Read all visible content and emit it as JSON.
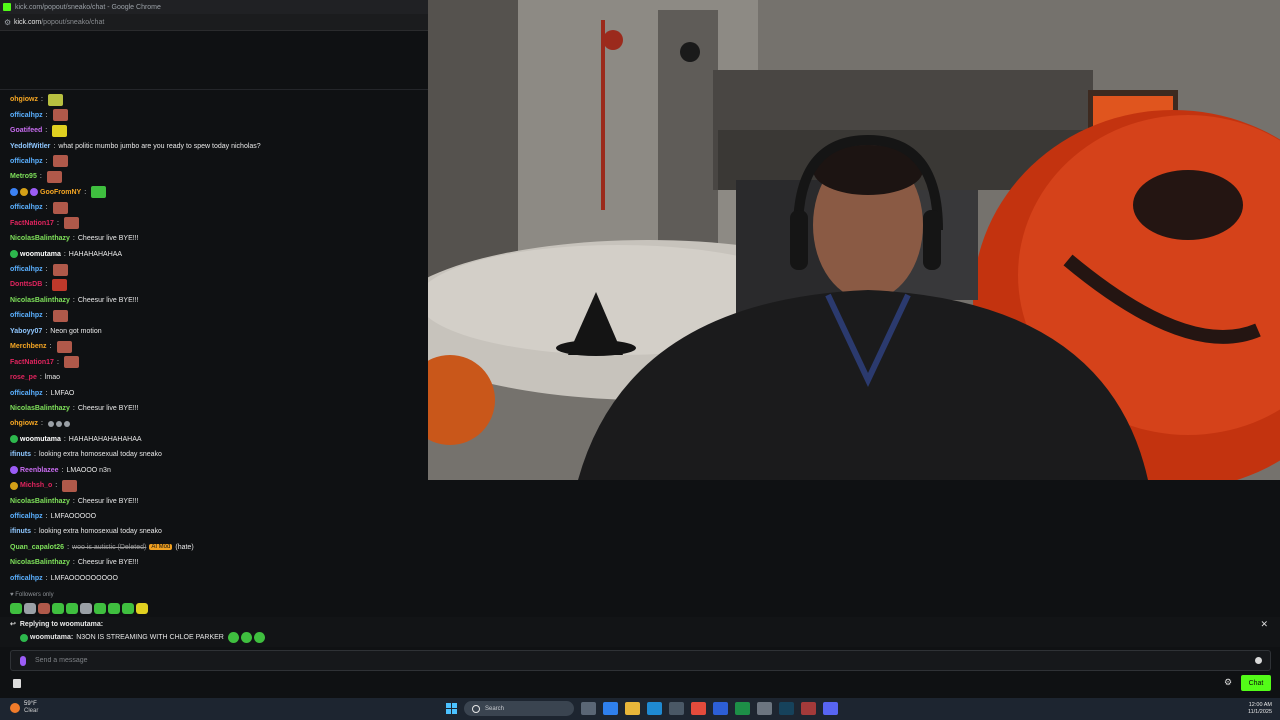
{
  "browser": {
    "window_title": "kick.com/popout/sneako/chat - Google Chrome",
    "url_host": "kick.com",
    "url_path": "/popout/sneako/chat"
  },
  "chat": {
    "messages": [
      {
        "user": "ohgiowz",
        "user_color": "#f5a623",
        "text": "",
        "emotes": [
          "#b8c040"
        ]
      },
      {
        "user": "officalhpz",
        "user_color": "#5ab0ff",
        "text": "",
        "emotes": [
          "#b0594a"
        ]
      },
      {
        "user": "Goatifeed",
        "user_color": "#c86cf0",
        "text": "",
        "emotes": [
          "#e0d020"
        ]
      },
      {
        "user": "YedolfWitler",
        "user_color": "#8fc7ff",
        "text": "what politic mumbo jumbo are you ready to spew today nicholas?",
        "emotes": []
      },
      {
        "user": "officalhpz",
        "user_color": "#5ab0ff",
        "text": "",
        "emotes": [
          "#b0594a"
        ]
      },
      {
        "user": "Metro95",
        "user_color": "#7ee05a",
        "text": "",
        "emotes": [
          "#b0594a"
        ]
      },
      {
        "user": "GooFromNY",
        "user_color": "#f5a623",
        "text": "",
        "emotes": [
          "#3fbf3f"
        ],
        "badges": [
          "#3b82f6",
          "#d4a017",
          "#9b5cf6"
        ]
      },
      {
        "user": "officalhpz",
        "user_color": "#5ab0ff",
        "text": "",
        "emotes": [
          "#b0594a"
        ]
      },
      {
        "user": "FactNation17",
        "user_color": "#e0245e",
        "text": "",
        "emotes": [
          "#b0594a"
        ]
      },
      {
        "user": "NicolasBalinthazy",
        "user_color": "#7ee05a",
        "text": "Cheesur live BYE!!!",
        "emotes": []
      },
      {
        "user": "woomutama",
        "user_color": "#ffffff",
        "text": "HAHAHAHAHAA",
        "emotes": [],
        "badges": [
          "#2db84d"
        ]
      },
      {
        "user": "officalhpz",
        "user_color": "#5ab0ff",
        "text": "",
        "emotes": [
          "#b0594a"
        ]
      },
      {
        "user": "DonttsDB",
        "user_color": "#e0245e",
        "text": "",
        "emotes": [
          "#c0392b"
        ]
      },
      {
        "user": "NicolasBalinthazy",
        "user_color": "#7ee05a",
        "text": "Cheesur live BYE!!!",
        "emotes": []
      },
      {
        "user": "officalhpz",
        "user_color": "#5ab0ff",
        "text": "",
        "emotes": [
          "#b0594a"
        ]
      },
      {
        "user": "Yaboyy07",
        "user_color": "#8fc7ff",
        "text": "Neon got motion",
        "emotes": []
      },
      {
        "user": "Merchbenz",
        "user_color": "#f5a623",
        "text": "",
        "emotes": [
          "#b0594a"
        ]
      },
      {
        "user": "FactNation17",
        "user_color": "#e0245e",
        "text": "",
        "emotes": [
          "#b0594a"
        ]
      },
      {
        "user": "rose_pe",
        "user_color": "#e0245e",
        "text": "lmao",
        "emotes": []
      },
      {
        "user": "officalhpz",
        "user_color": "#5ab0ff",
        "text": "LMFAO",
        "emotes": []
      },
      {
        "user": "NicolasBalinthazy",
        "user_color": "#7ee05a",
        "text": "Cheesur live BYE!!!",
        "emotes": []
      },
      {
        "user": "ohgiowz",
        "user_color": "#f5a623",
        "text": "",
        "emotes": [
          "#9aa0a6",
          "#9aa0a6",
          "#9aa0a6"
        ]
      },
      {
        "user": "woomutama",
        "user_color": "#ffffff",
        "text": "HAHAHAHAHAHAHAA",
        "emotes": [],
        "badges": [
          "#2db84d"
        ]
      },
      {
        "user": "ifinuts",
        "user_color": "#8fc7ff",
        "text": "looking extra homosexual today sneako",
        "emotes": []
      },
      {
        "user": "Reenblazee",
        "user_color": "#c86cf0",
        "text": "LMAOOO n3n",
        "emotes": [],
        "badges": [
          "#9b5cf6"
        ]
      },
      {
        "user": "Michsh_o",
        "user_color": "#e0245e",
        "text": "",
        "emotes": [
          "#b0594a"
        ],
        "badges": [
          "#d4a017"
        ]
      },
      {
        "user": "NicolasBalinthazy",
        "user_color": "#7ee05a",
        "text": "Cheesur live BYE!!!",
        "emotes": []
      },
      {
        "user": "officalhpz",
        "user_color": "#5ab0ff",
        "text": "LMFAOOOOO",
        "emotes": []
      },
      {
        "user": "ifinuts",
        "user_color": "#8fc7ff",
        "text": "looking extra homosexual today sneako",
        "emotes": []
      },
      {
        "user": "Quan_capalot26",
        "user_color": "#7ee05a",
        "text": "woo is autistic (Deleted)",
        "tag": "AI Mod",
        "tag_suffix": "(hate)",
        "emotes": []
      },
      {
        "user": "NicolasBalinthazy",
        "user_color": "#7ee05a",
        "text": "Cheesur live BYE!!!",
        "emotes": []
      },
      {
        "user": "officalhpz",
        "user_color": "#5ab0ff",
        "text": "LMFAOOOOOOOOO",
        "emotes": []
      }
    ],
    "followers_only_label": "Followers only",
    "emote_bar": [
      "#3fbf3f",
      "#9aa0a6",
      "#b0594a",
      "#3fbf3f",
      "#3fbf3f",
      "#9aa0a6",
      "#3fbf3f",
      "#3fbf3f",
      "#3fbf3f",
      "#e0d020"
    ]
  },
  "reply": {
    "heading": "Replying to woomutama:",
    "quoted_user": "woomutama",
    "quoted_text": "N3ON IS STREAMING WITH CHLOE PARKER"
  },
  "input": {
    "placeholder": "Send a message"
  },
  "actions": {
    "chat_button": "Chat"
  },
  "taskbar": {
    "temperature": "59°F",
    "condition": "Clear",
    "search_label": "Search",
    "time": "12:00 AM",
    "date": "11/1/2025"
  },
  "colors": {
    "kick_green": "#53fc18",
    "chat_bg": "#0f1113",
    "taskbar_bg": "#1d2530"
  }
}
